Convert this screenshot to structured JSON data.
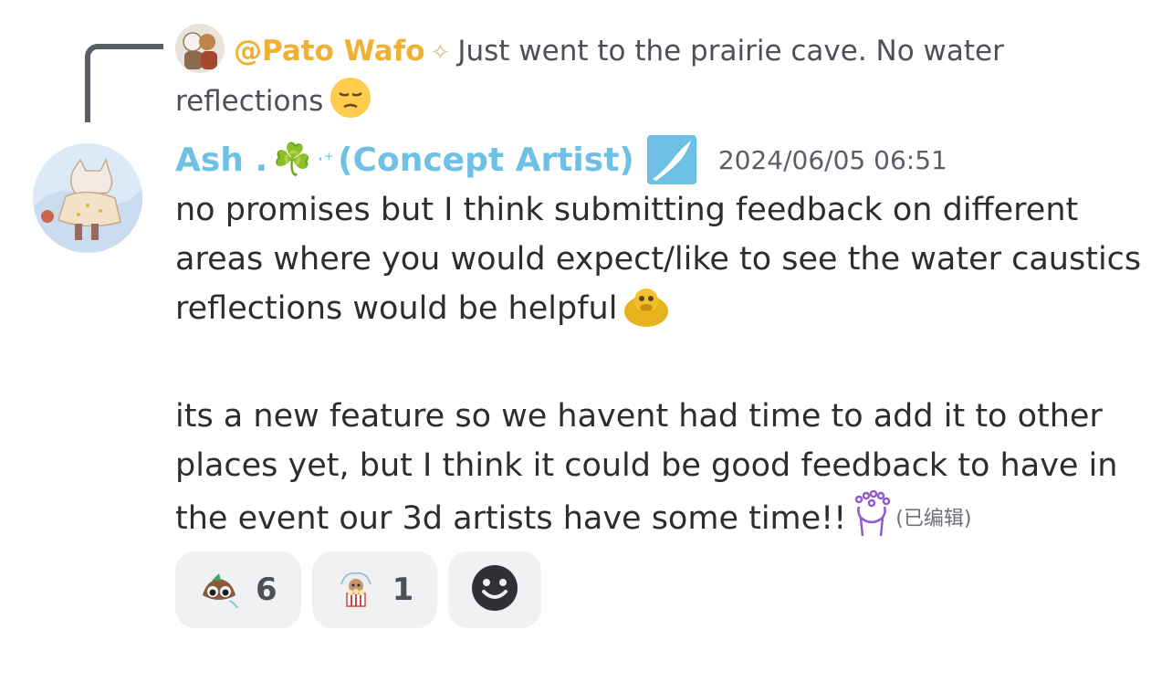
{
  "reply": {
    "author": "@Pato Wafo",
    "author_decoration": "✧",
    "text": "Just went to the prairie cave. No water reflections",
    "emoji_icon": "pensive-face-icon"
  },
  "message": {
    "author": "Ash .",
    "author_clover": "☘️",
    "author_sparkle": "·⁺",
    "author_role": "(Concept Artist)",
    "role_icon": "brush-stroke-icon",
    "timestamp": "2024/06/05 06:51",
    "paragraph1": "no promises but I think submitting feedback on different areas where you would expect/like to see the water caustics reflections would be helpful",
    "paragraph1_emoji": "thinking-blob-icon",
    "paragraph2": "its a new feature so we havent had time to add it to other places yet, but I think it could be good feedback to have in the event our 3d artists have some time!!",
    "paragraph2_emoji": "sparkle-hands-icon",
    "edited_label": "(已编辑)"
  },
  "reactions": [
    {
      "emoji": "blob-eyes-icon",
      "count": "6"
    },
    {
      "emoji": "popcorn-character-icon",
      "count": "1"
    }
  ],
  "add_reaction_icon": "smiley-add-icon",
  "colors": {
    "author": "#6ec1e4",
    "reply_author": "#f0b132",
    "reaction_bg": "#f0f1f3",
    "spine": "#5b5e66"
  }
}
